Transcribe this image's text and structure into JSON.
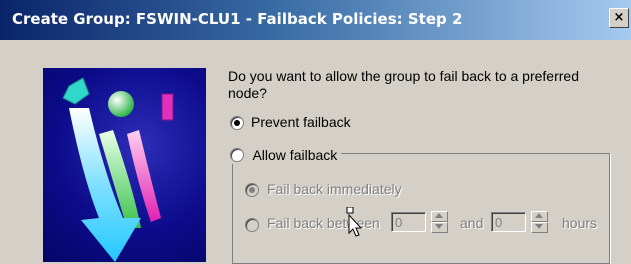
{
  "window": {
    "title": "Create Group: FSWIN-CLU1 - Failback Policies:  Step 2",
    "close_label": "×"
  },
  "question": "Do you want to allow the group to fail back to a preferred node?",
  "options": {
    "prevent": {
      "label": "Prevent failback",
      "selected": true
    },
    "allow": {
      "label": "Allow failback",
      "selected": false
    }
  },
  "allow_group": {
    "immediately": {
      "label": "Fail back immediately",
      "selected": true,
      "enabled": false
    },
    "between": {
      "label": "Fail back between",
      "selected": false,
      "enabled": false,
      "from_value": "0",
      "and_label": "and",
      "to_value": "0",
      "unit_label": "hours"
    }
  },
  "colors": {
    "title_start": "#0a246a",
    "title_end": "#a6caf0",
    "dialog_bg": "#d4d0c8",
    "disabled_text": "#808080"
  }
}
